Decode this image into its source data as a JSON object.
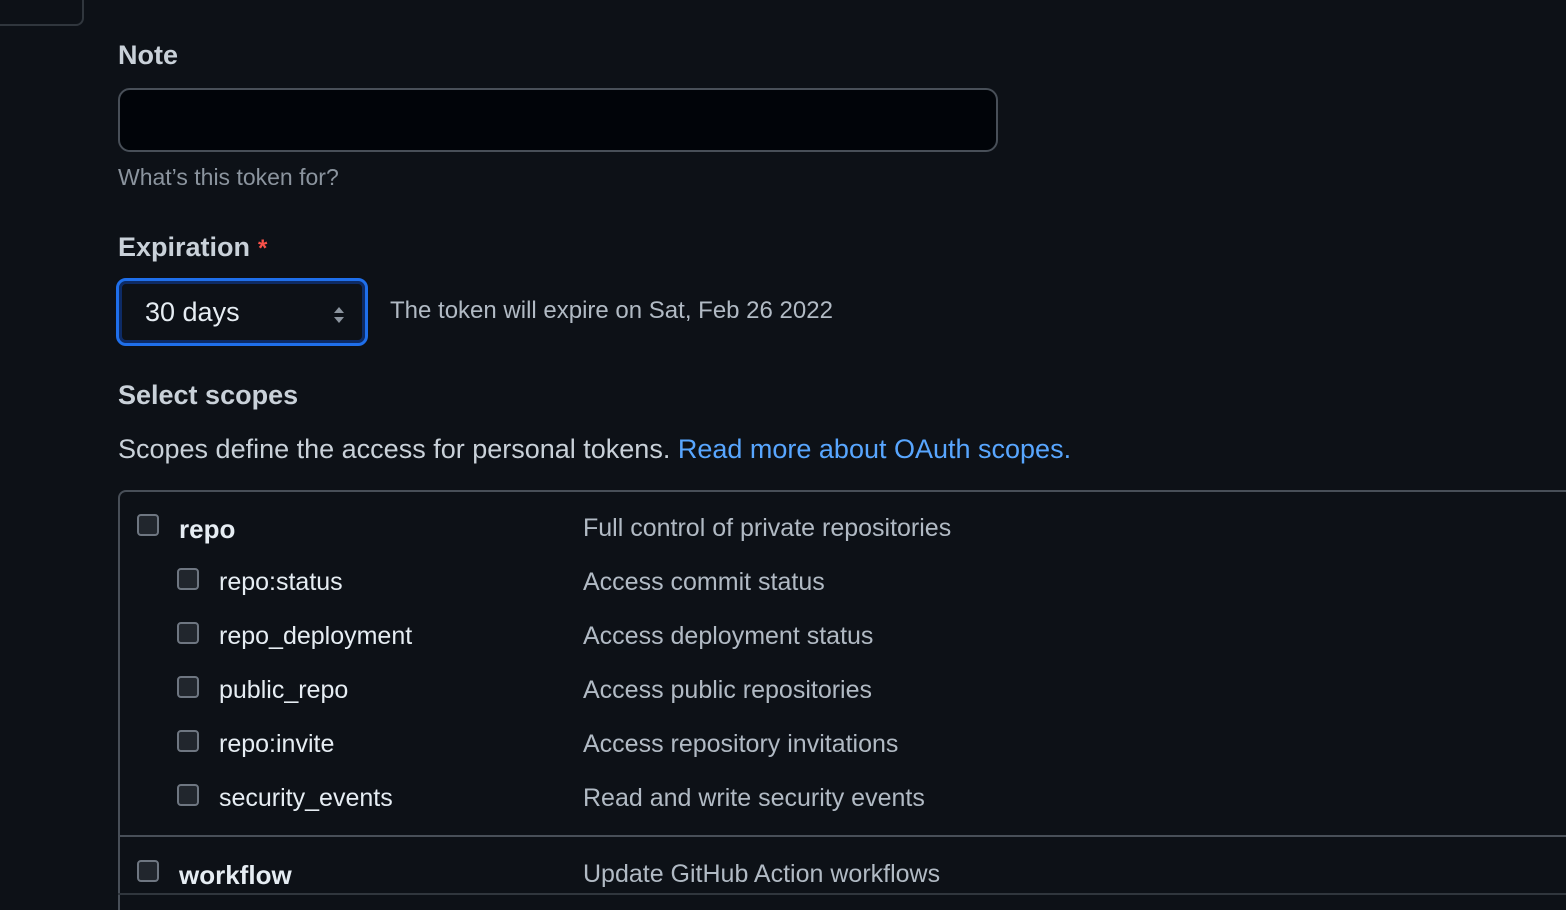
{
  "note": {
    "label": "Note",
    "value": "",
    "hint": "What’s this token for?"
  },
  "expiration": {
    "label": "Expiration",
    "required_mark": "*",
    "selected": "30 days",
    "description": "The token will expire on Sat, Feb 26 2022"
  },
  "scopes": {
    "title": "Select scopes",
    "intro": "Scopes define the access for personal tokens.",
    "link": "Read more about OAuth scopes.",
    "items": [
      {
        "name": "repo",
        "description": "Full control of private repositories",
        "checked": false,
        "parent": true
      },
      {
        "name": "repo:status",
        "description": "Access commit status",
        "checked": false,
        "parent": false
      },
      {
        "name": "repo_deployment",
        "description": "Access deployment status",
        "checked": false,
        "parent": false
      },
      {
        "name": "public_repo",
        "description": "Access public repositories",
        "checked": false,
        "parent": false
      },
      {
        "name": "repo:invite",
        "description": "Access repository invitations",
        "checked": false,
        "parent": false
      },
      {
        "name": "security_events",
        "description": "Read and write security events",
        "checked": false,
        "parent": false
      },
      {
        "name": "workflow",
        "description": "Update GitHub Action workflows",
        "checked": false,
        "parent": true
      }
    ]
  },
  "colors": {
    "background": "#0d1117",
    "link": "#58a6ff",
    "focus_border": "#1f6feb",
    "required": "#f85149"
  }
}
